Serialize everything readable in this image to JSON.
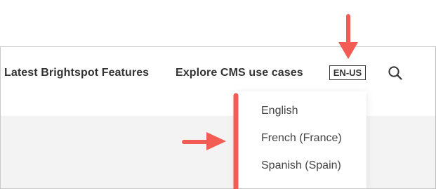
{
  "nav": {
    "links": [
      {
        "label": "Latest Brightspot Features"
      },
      {
        "label": "Explore CMS use cases"
      }
    ],
    "language_button": "EN-US",
    "search_icon": "search-icon"
  },
  "language_menu": {
    "options": [
      {
        "label": "English"
      },
      {
        "label": "French (France)"
      },
      {
        "label": "Spanish (Spain)"
      }
    ]
  },
  "annotation": {
    "color": "#f25c54"
  }
}
